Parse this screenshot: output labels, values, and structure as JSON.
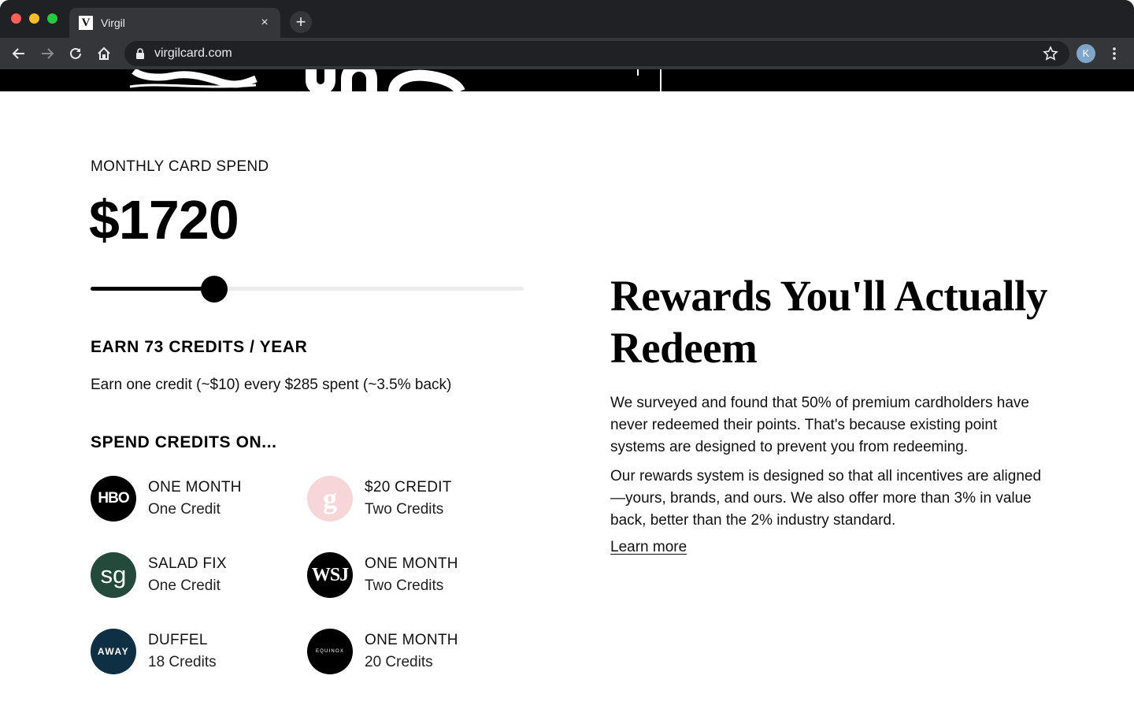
{
  "browser": {
    "tab_title": "Virgil",
    "tab_favicon": "V",
    "url": "virgilcard.com",
    "profile_initial": "K",
    "new_tab_label": "+",
    "close_tab_label": "×"
  },
  "calculator": {
    "label": "MONTHLY CARD SPEND",
    "amount": "$1720",
    "slider_fraction": 0.285,
    "earn_heading": "EARN 73 CREDITS / YEAR",
    "earn_description": "Earn one credit (~$10) every $285 spent (~3.5% back)",
    "spend_heading": "SPEND CREDITS ON...",
    "rewards": [
      {
        "logo": "HBO",
        "logo_name": "hbo-logo",
        "title": "ONE MONTH",
        "cost": "One Credit"
      },
      {
        "logo": "g",
        "logo_name": "glossier-logo",
        "title": "$20 CREDIT",
        "cost": "Two Credits"
      },
      {
        "logo": "sg",
        "logo_name": "sweetgreen-logo",
        "title": "SALAD FIX",
        "cost": "One Credit"
      },
      {
        "logo": "WSJ",
        "logo_name": "wsj-logo",
        "title": "ONE MONTH",
        "cost": "Two Credits"
      },
      {
        "logo": "AWAY",
        "logo_name": "away-logo",
        "title": "DUFFEL",
        "cost": "18 Credits"
      },
      {
        "logo": "EQUINOX",
        "logo_name": "equinox-logo",
        "title": "ONE MONTH",
        "cost": "20 Credits"
      }
    ]
  },
  "info": {
    "headline": "Rewards You'll Actually Redeem",
    "paragraph_1": "We surveyed and found that 50% of premium cardholders have never redeemed their points. That's because existing point systems are designed to prevent you from redeeming.",
    "paragraph_2": "Our rewards system is designed so that all incentives are aligned—yours, brands, and ours. We also offer more than 3% in value back, better than the 2% industry standard.",
    "learn_more": "Learn more"
  },
  "colors": {
    "chrome_dark": "#202124",
    "chrome_toolbar": "#35363a",
    "accent": "#000000",
    "hbo": "#000000",
    "glossier": "#f7d6d9",
    "sweetgreen": "#234a3a",
    "wsj": "#000000",
    "away": "#0f2f45",
    "equinox": "#000000"
  }
}
